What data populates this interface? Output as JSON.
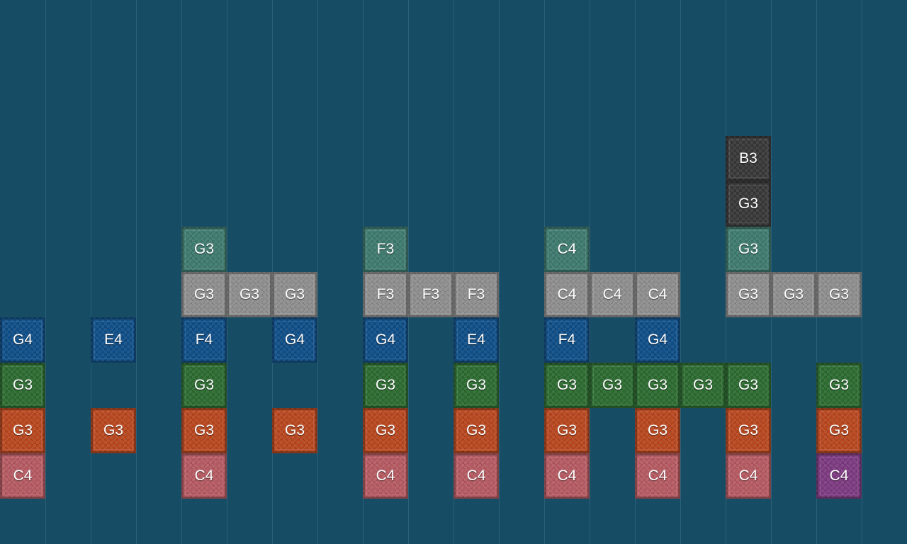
{
  "instruments": {
    "bass": {
      "color": "#b65a62"
    },
    "harp": {
      "color": "#b8471f"
    },
    "flute": {
      "color": "#2c6b30"
    },
    "bell": {
      "color": "#0f4e87"
    },
    "chime": {
      "color": "#8e8e8e"
    },
    "guitar": {
      "color": "#3e7a6e"
    },
    "drum": {
      "color": "#383838"
    },
    "special": {
      "color": "#7d3a80"
    }
  },
  "notes": [
    {
      "tick": 0,
      "layer": 0,
      "instrument": "bass",
      "label": "C4"
    },
    {
      "tick": 0,
      "layer": 1,
      "instrument": "harp",
      "label": "G3"
    },
    {
      "tick": 0,
      "layer": 2,
      "instrument": "flute",
      "label": "G3"
    },
    {
      "tick": 0,
      "layer": 3,
      "instrument": "bell",
      "label": "G4"
    },
    {
      "tick": 2,
      "layer": 1,
      "instrument": "harp",
      "label": "G3"
    },
    {
      "tick": 2,
      "layer": 3,
      "instrument": "bell",
      "label": "E4"
    },
    {
      "tick": 4,
      "layer": 0,
      "instrument": "bass",
      "label": "C4"
    },
    {
      "tick": 4,
      "layer": 1,
      "instrument": "harp",
      "label": "G3"
    },
    {
      "tick": 4,
      "layer": 2,
      "instrument": "flute",
      "label": "G3"
    },
    {
      "tick": 4,
      "layer": 3,
      "instrument": "bell",
      "label": "F4"
    },
    {
      "tick": 4,
      "layer": 4,
      "instrument": "chime",
      "label": "G3"
    },
    {
      "tick": 4,
      "layer": 5,
      "instrument": "guitar",
      "label": "G3"
    },
    {
      "tick": 5,
      "layer": 4,
      "instrument": "chime",
      "label": "G3"
    },
    {
      "tick": 6,
      "layer": 1,
      "instrument": "harp",
      "label": "G3"
    },
    {
      "tick": 6,
      "layer": 3,
      "instrument": "bell",
      "label": "G4"
    },
    {
      "tick": 6,
      "layer": 4,
      "instrument": "chime",
      "label": "G3"
    },
    {
      "tick": 8,
      "layer": 0,
      "instrument": "bass",
      "label": "C4"
    },
    {
      "tick": 8,
      "layer": 1,
      "instrument": "harp",
      "label": "G3"
    },
    {
      "tick": 8,
      "layer": 2,
      "instrument": "flute",
      "label": "G3"
    },
    {
      "tick": 8,
      "layer": 3,
      "instrument": "bell",
      "label": "G4"
    },
    {
      "tick": 8,
      "layer": 4,
      "instrument": "chime",
      "label": "F3"
    },
    {
      "tick": 8,
      "layer": 5,
      "instrument": "guitar",
      "label": "F3"
    },
    {
      "tick": 9,
      "layer": 4,
      "instrument": "chime",
      "label": "F3"
    },
    {
      "tick": 10,
      "layer": 0,
      "instrument": "bass",
      "label": "C4"
    },
    {
      "tick": 10,
      "layer": 1,
      "instrument": "harp",
      "label": "G3"
    },
    {
      "tick": 10,
      "layer": 2,
      "instrument": "flute",
      "label": "G3"
    },
    {
      "tick": 10,
      "layer": 3,
      "instrument": "bell",
      "label": "E4"
    },
    {
      "tick": 10,
      "layer": 4,
      "instrument": "chime",
      "label": "F3"
    },
    {
      "tick": 12,
      "layer": 0,
      "instrument": "bass",
      "label": "C4"
    },
    {
      "tick": 12,
      "layer": 1,
      "instrument": "harp",
      "label": "G3"
    },
    {
      "tick": 12,
      "layer": 2,
      "instrument": "flute",
      "label": "G3"
    },
    {
      "tick": 12,
      "layer": 3,
      "instrument": "bell",
      "label": "F4"
    },
    {
      "tick": 12,
      "layer": 4,
      "instrument": "chime",
      "label": "C4"
    },
    {
      "tick": 12,
      "layer": 5,
      "instrument": "guitar",
      "label": "C4"
    },
    {
      "tick": 13,
      "layer": 2,
      "instrument": "flute",
      "label": "G3"
    },
    {
      "tick": 13,
      "layer": 4,
      "instrument": "chime",
      "label": "C4"
    },
    {
      "tick": 14,
      "layer": 0,
      "instrument": "bass",
      "label": "C4"
    },
    {
      "tick": 14,
      "layer": 1,
      "instrument": "harp",
      "label": "G3"
    },
    {
      "tick": 14,
      "layer": 2,
      "instrument": "flute",
      "label": "G3"
    },
    {
      "tick": 14,
      "layer": 3,
      "instrument": "bell",
      "label": "G4"
    },
    {
      "tick": 14,
      "layer": 4,
      "instrument": "chime",
      "label": "C4"
    },
    {
      "tick": 15,
      "layer": 2,
      "instrument": "flute",
      "label": "G3"
    },
    {
      "tick": 16,
      "layer": 0,
      "instrument": "bass",
      "label": "C4"
    },
    {
      "tick": 16,
      "layer": 1,
      "instrument": "harp",
      "label": "G3"
    },
    {
      "tick": 16,
      "layer": 2,
      "instrument": "flute",
      "label": "G3"
    },
    {
      "tick": 16,
      "layer": 4,
      "instrument": "chime",
      "label": "G3"
    },
    {
      "tick": 16,
      "layer": 5,
      "instrument": "guitar",
      "label": "G3"
    },
    {
      "tick": 16,
      "layer": 6,
      "instrument": "drum",
      "label": "G3"
    },
    {
      "tick": 16,
      "layer": 7,
      "instrument": "drum",
      "label": "B3"
    },
    {
      "tick": 17,
      "layer": 4,
      "instrument": "chime",
      "label": "G3"
    },
    {
      "tick": 18,
      "layer": 0,
      "instrument": "special",
      "label": "C4"
    },
    {
      "tick": 18,
      "layer": 1,
      "instrument": "harp",
      "label": "G3"
    },
    {
      "tick": 18,
      "layer": 2,
      "instrument": "flute",
      "label": "G3"
    },
    {
      "tick": 18,
      "layer": 4,
      "instrument": "chime",
      "label": "G3"
    }
  ]
}
